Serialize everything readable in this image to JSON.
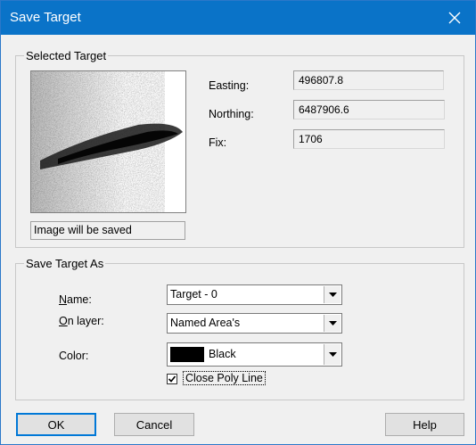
{
  "window": {
    "title": "Save Target"
  },
  "selected_target": {
    "group_label": "Selected Target",
    "image_caption": "Image will be saved",
    "easting_label": "Easting:",
    "easting_value": "496807.8",
    "northing_label": "Northing:",
    "northing_value": "6487906.6",
    "fix_label": "Fix:",
    "fix_value": "1706"
  },
  "save_as": {
    "group_label": "Save Target As",
    "name_label_u": "N",
    "name_label_rest": "ame:",
    "name_value": "Target - 0",
    "layer_label_u": "O",
    "layer_label_rest": "n layer:",
    "layer_value": "Named Area's",
    "color_label": "Color:",
    "color_value": "Black",
    "color_swatch": "#000000",
    "close_poly_label": "Close Poly Line",
    "close_poly_checked": true
  },
  "buttons": {
    "ok": "OK",
    "cancel": "Cancel",
    "help": "Help"
  },
  "icons": {
    "close": "close-icon",
    "dropdown": "chevron-down-icon",
    "check": "check-icon"
  }
}
